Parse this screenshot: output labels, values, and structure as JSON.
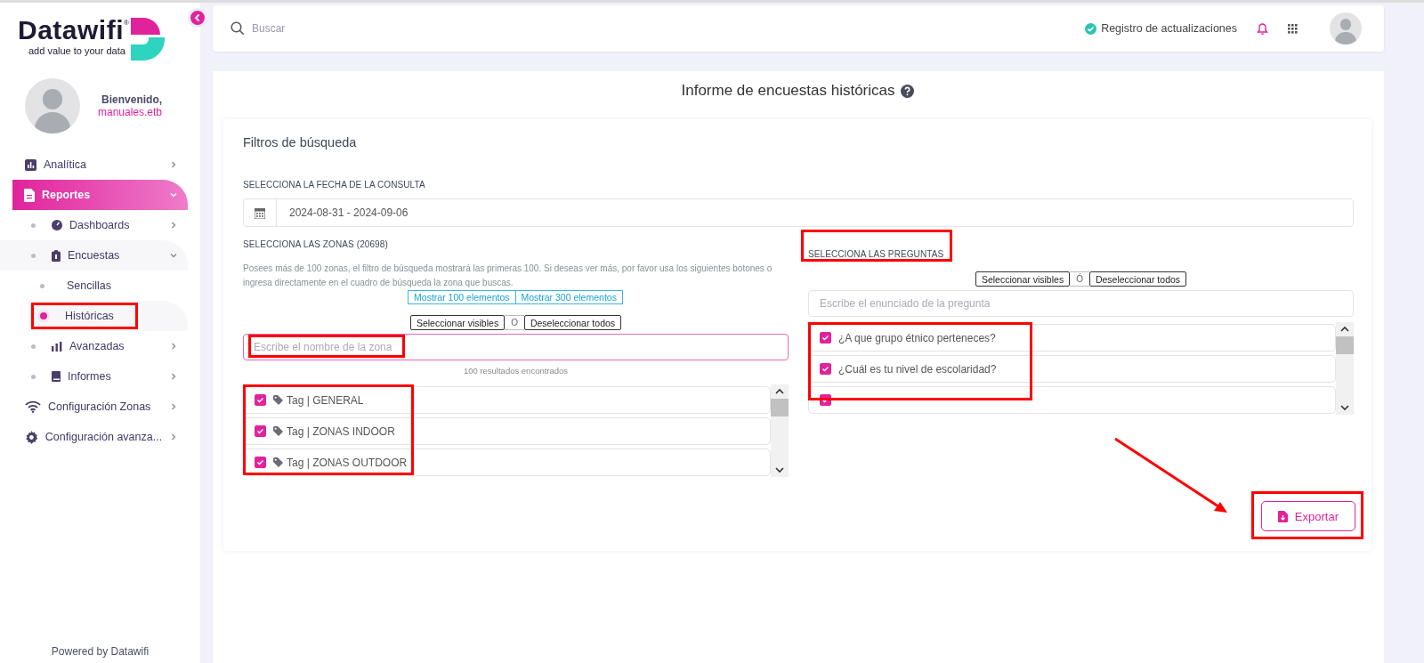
{
  "brand": {
    "name": "Datawifi",
    "registered": "®",
    "tagline": "add value to your data"
  },
  "profile": {
    "greeting": "Bienvenido,",
    "user": "manuales.etb"
  },
  "nav": [
    {
      "label": "Analítica",
      "expanded": false,
      "selected": false
    },
    {
      "label": "Reportes",
      "expanded": true,
      "selected": true,
      "children": [
        {
          "label": "Dashboards",
          "expanded": false
        },
        {
          "label": "Encuestas",
          "expanded": true,
          "children": [
            {
              "label": "Sencillas",
              "selected": false,
              "highlighted": false
            },
            {
              "label": "Históricas",
              "selected": true,
              "highlighted": true
            }
          ]
        },
        {
          "label": "Avanzadas",
          "expanded": false
        },
        {
          "label": "Informes",
          "expanded": false
        }
      ]
    },
    {
      "label": "Configuración Zonas",
      "expanded": false,
      "selected": false
    },
    {
      "label": "Configuración avanza...",
      "expanded": false,
      "selected": false
    }
  ],
  "footer": "Powered by Datawifi",
  "topbar": {
    "search_placeholder": "Buscar",
    "updates_link": "Registro de actualizaciones"
  },
  "page_title": "Informe de encuestas históricas",
  "filters": {
    "title": "Filtros de búsqueda",
    "date": {
      "label": "SELECCIONA LA FECHA DE LA CONSULTA",
      "value": "2024-08-31 - 2024-09-06"
    },
    "zones": {
      "label": "SELECCIONA LAS ZONAS (20698)",
      "note": "Posees más de 100 zonas, el filtro de búsqueda mostrará las primeras 100. Si deseas ver más, por favor usa los siguientes botones o ingresa directamente en el cuadro de búsqueda la zona que buscas.",
      "show_buttons": [
        "Mostrar 100 elementos",
        "Mostrar 300 elementos"
      ],
      "select_visible": "Seleccionar visibles",
      "separator": "O",
      "deselect_all": "Deseleccionar todos",
      "placeholder": "Escribe el nombre de la zona",
      "placeholder_highlighted": true,
      "results": "100 resultados encontrados",
      "list_highlighted": true,
      "items": [
        {
          "label": "Tag | GENERAL",
          "checked": true
        },
        {
          "label": "Tag | ZONAS INDOOR",
          "checked": true
        },
        {
          "label": "Tag | ZONAS OUTDOOR",
          "checked": true
        }
      ]
    },
    "questions": {
      "label": "SELECCIONA LAS PREGUNTAS",
      "label_highlighted": true,
      "select_visible": "Seleccionar visibles",
      "separator": "Ó",
      "deselect_all": "Deseleccionar todos",
      "placeholder": "Escribe el enunciado de la pregunta",
      "list_highlighted": true,
      "items": [
        {
          "label": "¿A que grupo étnico perteneces?",
          "checked": true
        },
        {
          "label": "¿Cuál es tu nivel de escolaridad?",
          "checked": true
        },
        {
          "checked": true
        }
      ]
    },
    "export": {
      "label": "Exportar",
      "highlighted": true,
      "arrow": true
    }
  }
}
